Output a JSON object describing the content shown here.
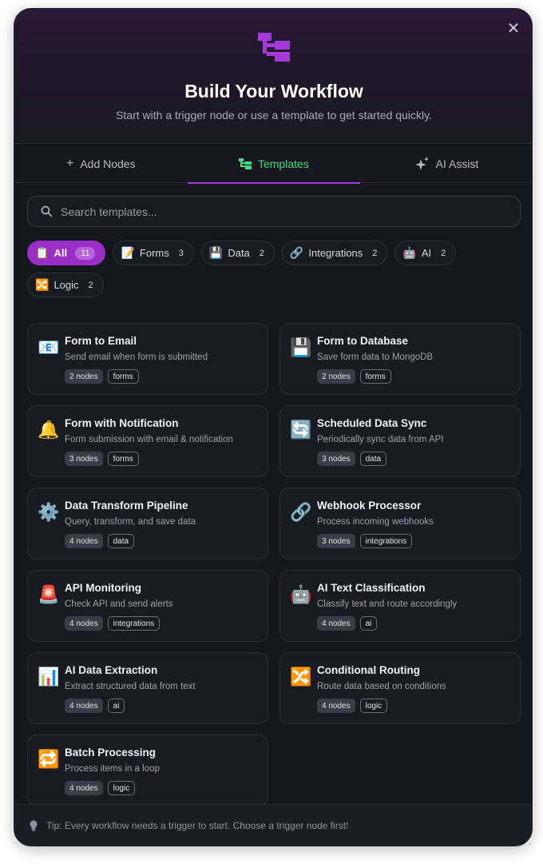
{
  "header": {
    "title": "Build Your Workflow",
    "subtitle": "Start with a trigger node or use a template to get started quickly.",
    "close_label": "✕",
    "logo_icon": "workflow-icon",
    "logo_color": "#a63ad8"
  },
  "tabs": [
    {
      "label": "Add Nodes",
      "icon": "+",
      "active": false
    },
    {
      "label": "Templates",
      "icon": "🌲",
      "active": true
    },
    {
      "label": "AI Assist",
      "icon": "✨",
      "active": false
    }
  ],
  "search": {
    "placeholder": "Search templates..."
  },
  "filters": [
    {
      "emoji": "📋",
      "label": "All",
      "count": "11",
      "active": true
    },
    {
      "emoji": "📝",
      "label": "Forms",
      "count": "3",
      "active": false
    },
    {
      "emoji": "💾",
      "label": "Data",
      "count": "2",
      "active": false
    },
    {
      "emoji": "🔗",
      "label": "Integrations",
      "count": "2",
      "active": false
    },
    {
      "emoji": "🤖",
      "label": "AI",
      "count": "2",
      "active": false
    },
    {
      "emoji": "🔀",
      "label": "Logic",
      "count": "2",
      "active": false
    }
  ],
  "templates": [
    {
      "emoji": "📧",
      "title": "Form to Email",
      "desc": "Send email when form is submitted",
      "nodes": "2 nodes",
      "category": "forms"
    },
    {
      "emoji": "💾",
      "title": "Form to Database",
      "desc": "Save form data to MongoDB",
      "nodes": "2 nodes",
      "category": "forms"
    },
    {
      "emoji": "🔔",
      "title": "Form with Notification",
      "desc": "Form submission with email & notification",
      "nodes": "3 nodes",
      "category": "forms"
    },
    {
      "emoji": "🔄",
      "title": "Scheduled Data Sync",
      "desc": "Periodically sync data from API",
      "nodes": "3 nodes",
      "category": "data"
    },
    {
      "emoji": "⚙️",
      "title": "Data Transform Pipeline",
      "desc": "Query, transform, and save data",
      "nodes": "4 nodes",
      "category": "data"
    },
    {
      "emoji": "🔗",
      "title": "Webhook Processor",
      "desc": "Process incoming webhooks",
      "nodes": "3 nodes",
      "category": "integrations"
    },
    {
      "emoji": "🚨",
      "title": "API Monitoring",
      "desc": "Check API and send alerts",
      "nodes": "4 nodes",
      "category": "integrations"
    },
    {
      "emoji": "🤖",
      "title": "AI Text Classification",
      "desc": "Classify text and route accordingly",
      "nodes": "4 nodes",
      "category": "ai"
    },
    {
      "emoji": "📊",
      "title": "AI Data Extraction",
      "desc": "Extract structured data from text",
      "nodes": "4 nodes",
      "category": "ai"
    },
    {
      "emoji": "🔀",
      "title": "Conditional Routing",
      "desc": "Route data based on conditions",
      "nodes": "4 nodes",
      "category": "logic"
    },
    {
      "emoji": "🔁",
      "title": "Batch Processing",
      "desc": "Process items in a loop",
      "nodes": "4 nodes",
      "category": "logic"
    }
  ],
  "footer": {
    "tip": "Tip: Every workflow needs a trigger to start. Choose a trigger node first!",
    "icon": "lightbulb-icon"
  }
}
